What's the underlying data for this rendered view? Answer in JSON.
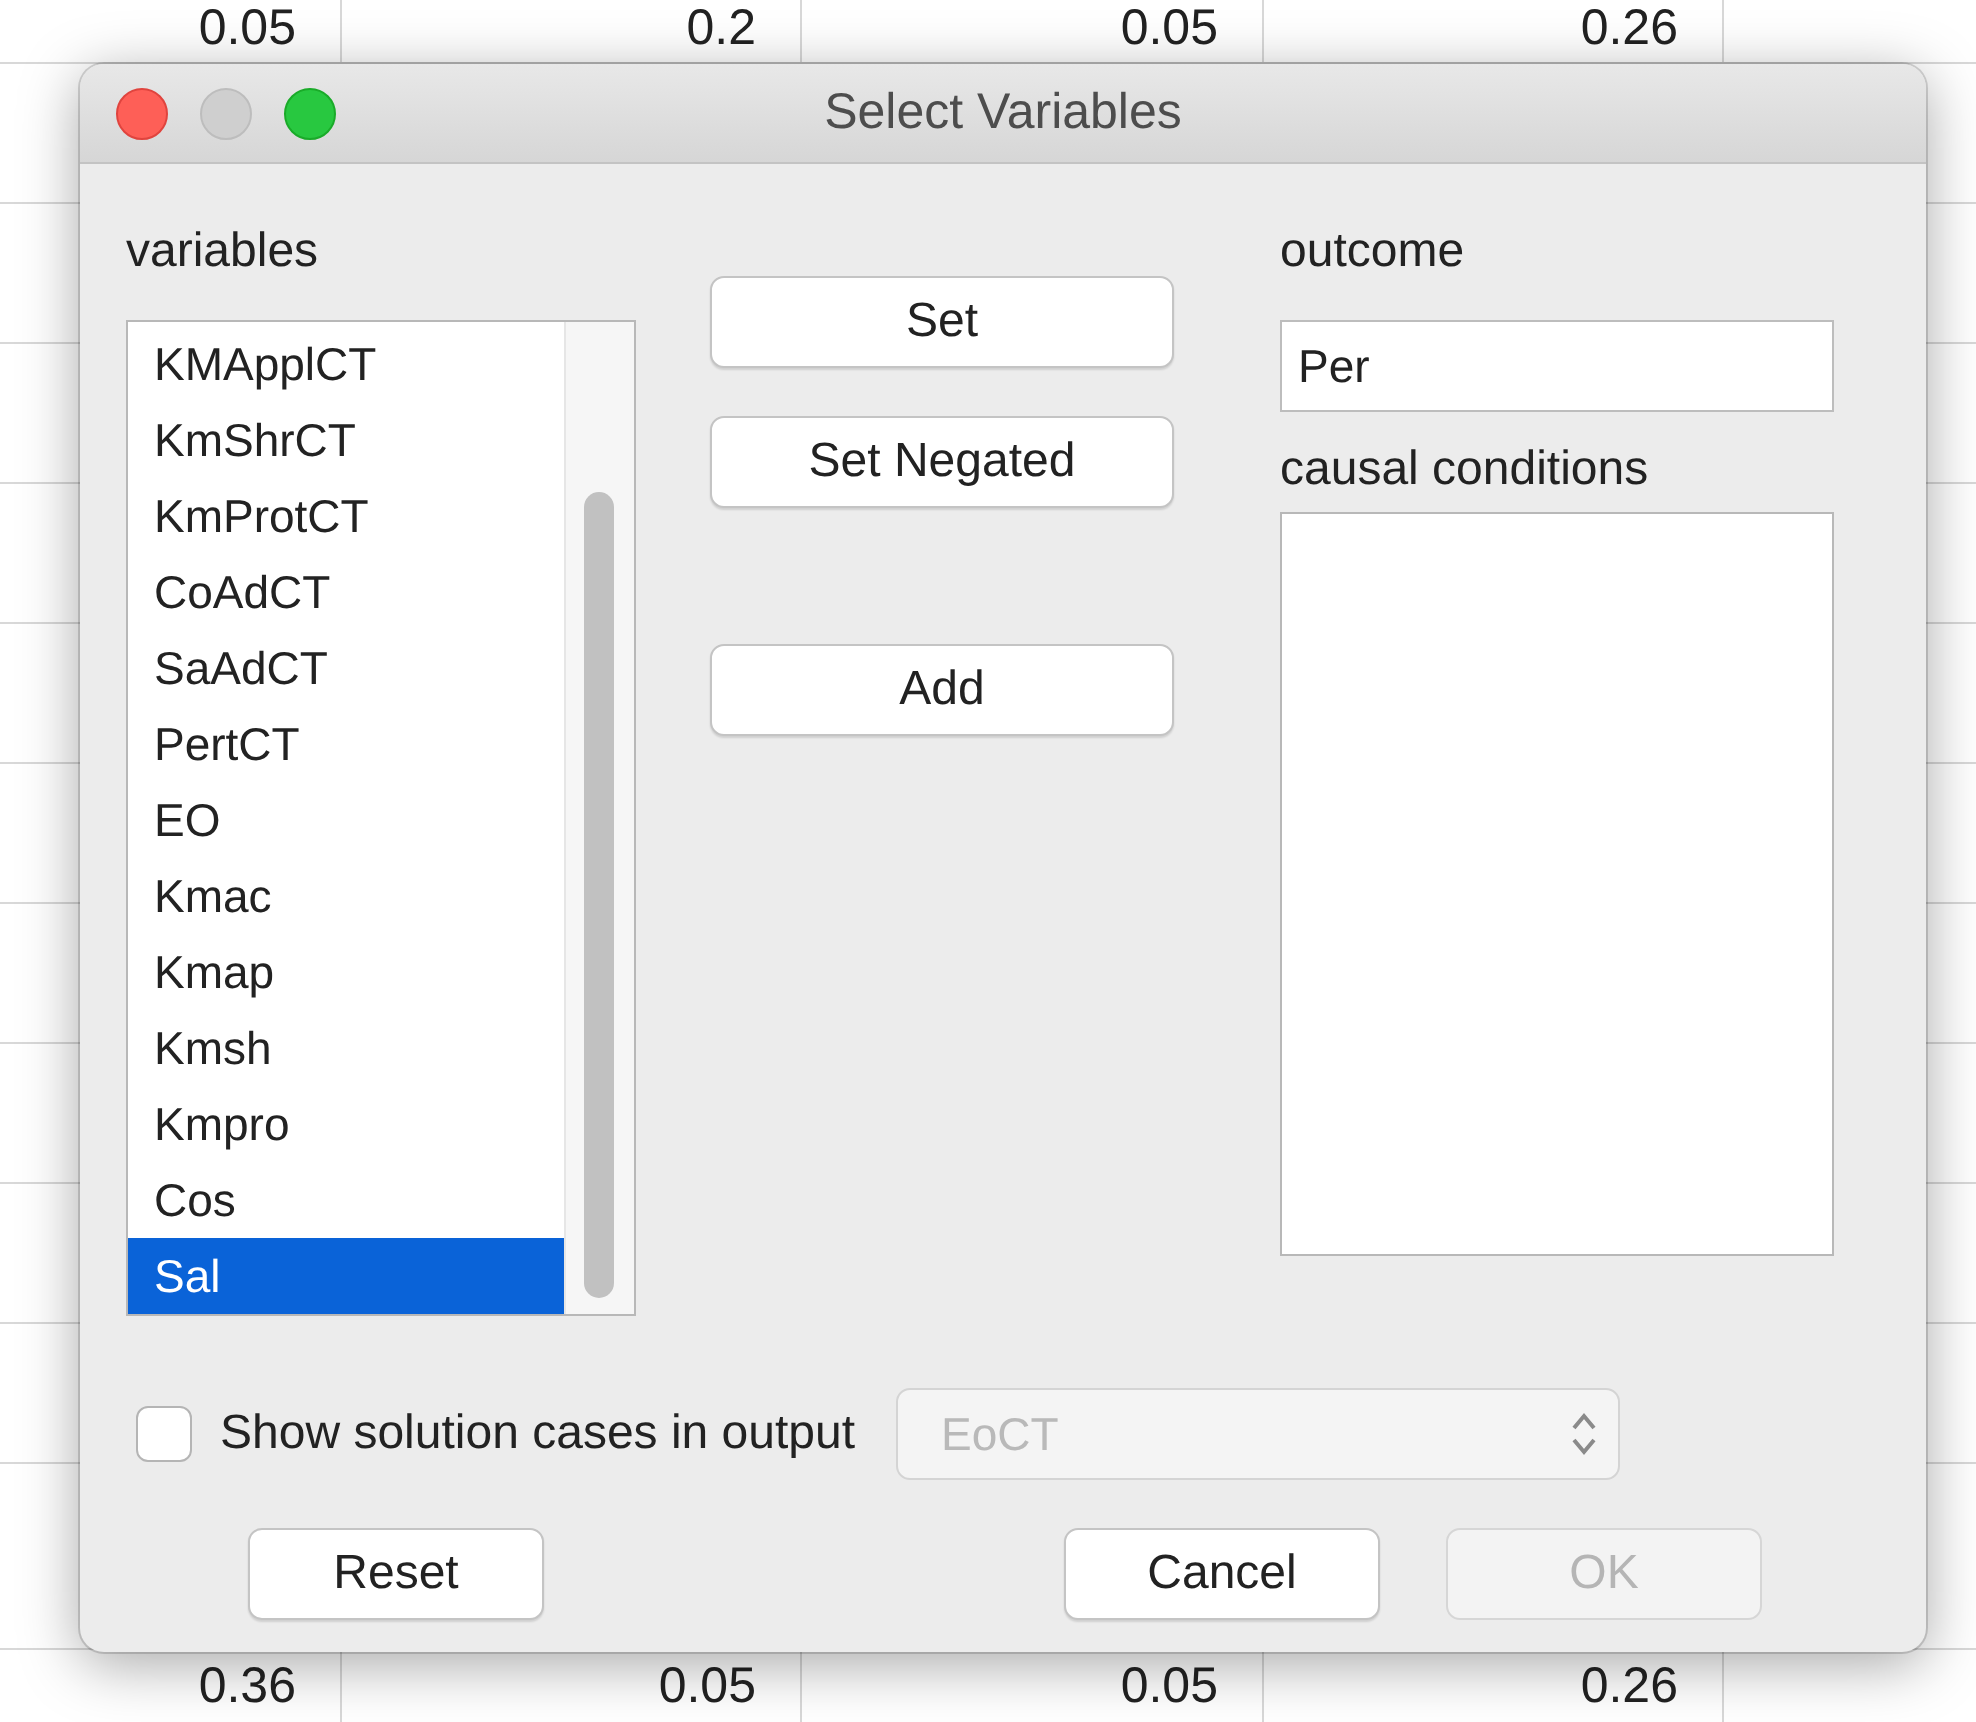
{
  "background_table": {
    "rows": [
      {
        "cells": [
          "0.05",
          "0.2",
          "0.05",
          "0.26"
        ]
      },
      {
        "cells": [
          "0.36",
          "0.05",
          "0.05",
          "0.26"
        ]
      }
    ]
  },
  "dialog": {
    "title": "Select Variables",
    "window_controls": [
      {
        "kind": "close",
        "disabled": false
      },
      {
        "kind": "minimize",
        "disabled": true
      },
      {
        "kind": "zoom",
        "disabled": false
      }
    ],
    "variables": {
      "label": "variables",
      "items": [
        {
          "label": "KMApplCT",
          "selected": false
        },
        {
          "label": "KmShrCT",
          "selected": false
        },
        {
          "label": "KmProtCT",
          "selected": false
        },
        {
          "label": "CoAdCT",
          "selected": false
        },
        {
          "label": "SaAdCT",
          "selected": false
        },
        {
          "label": "PertCT",
          "selected": false
        },
        {
          "label": "EO",
          "selected": false
        },
        {
          "label": "Kmac",
          "selected": false
        },
        {
          "label": "Kmap",
          "selected": false
        },
        {
          "label": "Kmsh",
          "selected": false
        },
        {
          "label": "Kmpro",
          "selected": false
        },
        {
          "label": "Cos",
          "selected": false
        },
        {
          "label": "Sal",
          "selected": true
        }
      ]
    },
    "actions": [
      {
        "label": "Set",
        "disabled": false
      },
      {
        "label": "Set Negated",
        "disabled": false
      },
      {
        "label": "Add",
        "disabled": false
      }
    ],
    "outcome": {
      "label": "outcome",
      "value": "Per"
    },
    "causal_conditions": {
      "label": "causal conditions"
    },
    "show_cases": {
      "label": "Show solution cases in output",
      "checked": false
    },
    "case_selector": {
      "value": "EoCT",
      "disabled": true
    },
    "buttons": [
      {
        "label": "Reset",
        "disabled": false
      },
      {
        "label": "Cancel",
        "disabled": false
      },
      {
        "label": "OK",
        "disabled": true
      }
    ]
  }
}
